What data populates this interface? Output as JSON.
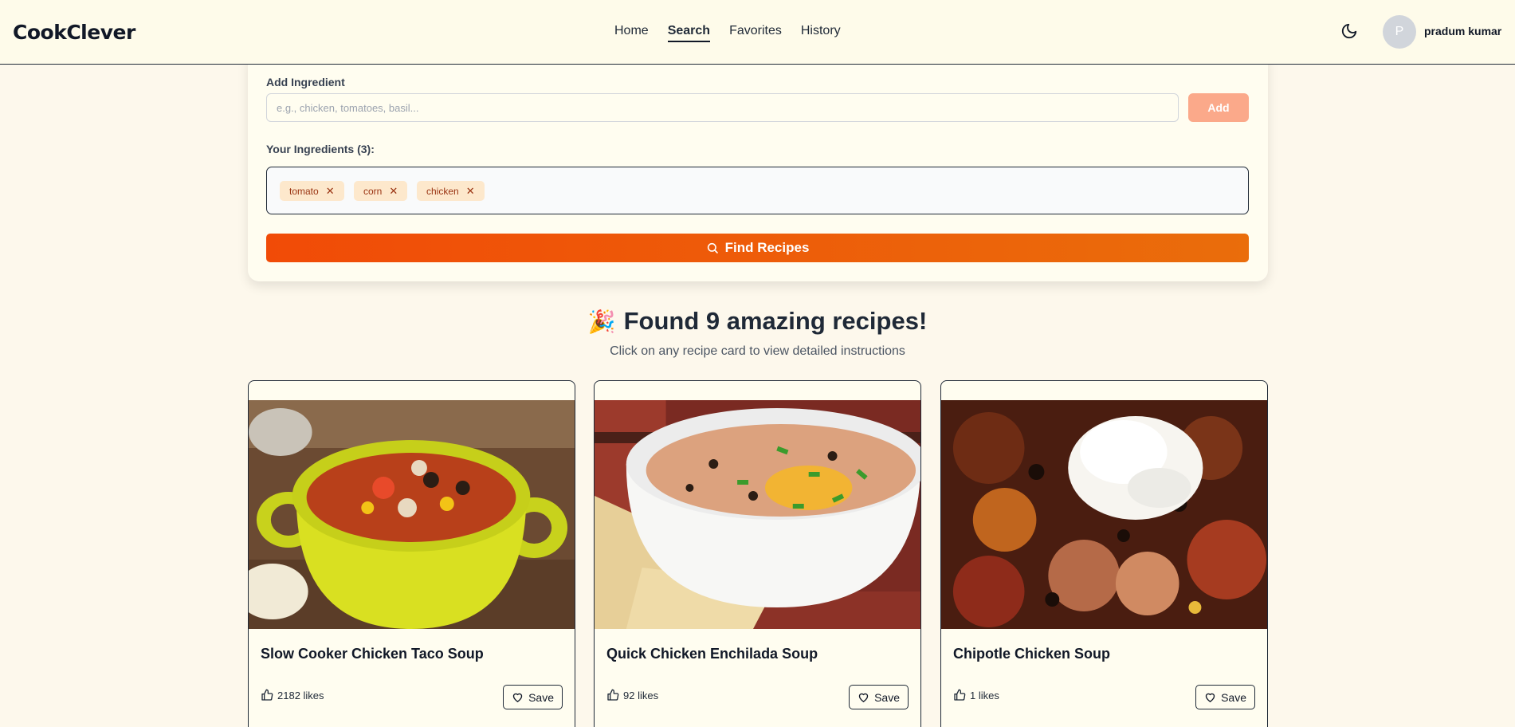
{
  "header": {
    "brand": "CookClever",
    "nav": [
      "Home",
      "Search",
      "Favorites",
      "History"
    ],
    "active_nav": "Search",
    "avatar_initial": "P",
    "username": "pradum kumar"
  },
  "search": {
    "add_label": "Add Ingredient",
    "placeholder": "e.g., chicken, tomatoes, basil...",
    "value": "",
    "add_button": "Add",
    "ingredients_label": "Your Ingredients (3):",
    "ingredients": [
      "tomato",
      "corn",
      "chicken"
    ],
    "remove_glyph": "✕",
    "find_button": "Find Recipes"
  },
  "results": {
    "emoji": "🎉",
    "title": "Found 9 amazing recipes!",
    "subtitle": "Click on any recipe card to view detailed instructions"
  },
  "recipes": [
    {
      "title": "Slow Cooker Chicken Taco Soup",
      "likes": "2182 likes",
      "save": "Save",
      "bowl_color": "#d9e021"
    },
    {
      "title": "Quick Chicken Enchilada Soup",
      "likes": "92 likes",
      "save": "Save",
      "bowl_color": "#f3f3f3"
    },
    {
      "title": "Chipotle Chicken Soup",
      "likes": "1 likes",
      "save": "Save",
      "bowl_color": "#5a2a14"
    }
  ],
  "colors": {
    "background": "#fdf8ec",
    "accent_start": "#f14b07",
    "accent_end": "#ea6d0b",
    "chip_bg": "#fde8cc",
    "add_button": "#fba98a"
  }
}
